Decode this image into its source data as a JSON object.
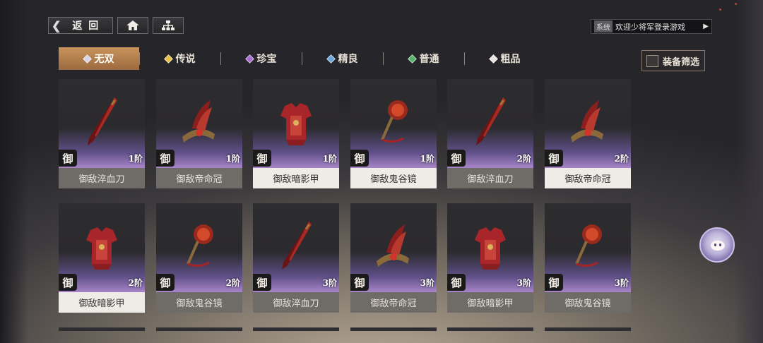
{
  "header": {
    "back_label": "返 回",
    "system_badge": "系统",
    "system_message": "欢迎少将军登录游戏"
  },
  "tabs": [
    {
      "label": "无双",
      "color": "#d9d3ea",
      "active": true
    },
    {
      "label": "传说",
      "color": "#e8c04a",
      "active": false
    },
    {
      "label": "珍宝",
      "color": "#a76ed1",
      "active": false
    },
    {
      "label": "精良",
      "color": "#6ea6d9",
      "active": false
    },
    {
      "label": "普通",
      "color": "#58b36a",
      "active": false
    },
    {
      "label": "粗品",
      "color": "#e9e6e0",
      "active": false
    }
  ],
  "filter_label": "装备筛选",
  "items": [
    {
      "name": "御敌淬血刀",
      "seal": "御",
      "tier": "1阶",
      "icon": "blade-icon"
    },
    {
      "name": "御敌帝命冠",
      "seal": "御",
      "tier": "1阶",
      "icon": "crown-icon"
    },
    {
      "name": "御敌暗影甲",
      "seal": "御",
      "tier": "1阶",
      "icon": "armor-icon",
      "selected": true
    },
    {
      "name": "御敌鬼谷镜",
      "seal": "御",
      "tier": "1阶",
      "icon": "mirror-icon",
      "selected": true
    },
    {
      "name": "御敌淬血刀",
      "seal": "御",
      "tier": "2阶",
      "icon": "blade-icon"
    },
    {
      "name": "御敌帝命冠",
      "seal": "御",
      "tier": "2阶",
      "icon": "crown-icon",
      "selected": true
    },
    {
      "name": "御敌暗影甲",
      "seal": "御",
      "tier": "2阶",
      "icon": "armor-icon",
      "selected": true
    },
    {
      "name": "御敌鬼谷镜",
      "seal": "御",
      "tier": "2阶",
      "icon": "mirror-icon"
    },
    {
      "name": "御敌淬血刀",
      "seal": "御",
      "tier": "3阶",
      "icon": "blade-icon"
    },
    {
      "name": "御敌帝命冠",
      "seal": "御",
      "tier": "3阶",
      "icon": "crown-icon"
    },
    {
      "name": "御敌暗影甲",
      "seal": "御",
      "tier": "3阶",
      "icon": "armor-icon"
    },
    {
      "name": "御敌鬼谷镜",
      "seal": "御",
      "tier": "3阶",
      "icon": "mirror-icon"
    }
  ]
}
